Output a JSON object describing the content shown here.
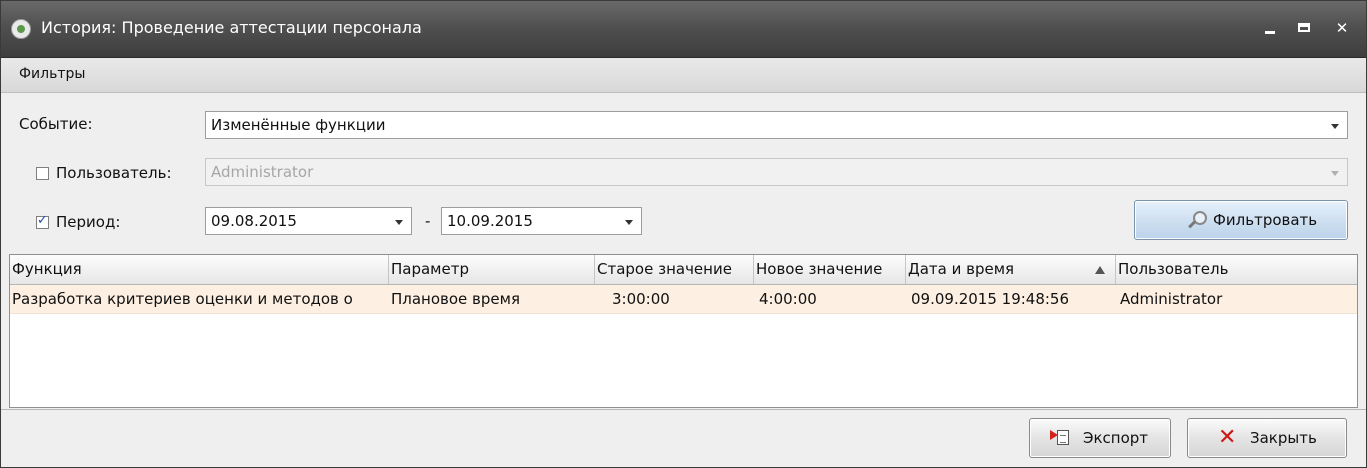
{
  "window": {
    "title": "История: Проведение аттестации персонала"
  },
  "filters": {
    "panel_title": "Фильтры",
    "event_label": "Событие:",
    "event_value": "Изменённые функции",
    "user_label": "Пользователь:",
    "user_checked": false,
    "user_value": "Administrator",
    "period_label": "Период:",
    "period_checked": true,
    "date_from": "09.08.2015",
    "date_separator": "-",
    "date_to": "10.09.2015",
    "filter_button": "Фильтровать"
  },
  "grid": {
    "columns": [
      "Функция",
      "Параметр",
      "Старое значение",
      "Новое значение",
      "Дата и время",
      "Пользователь"
    ],
    "sort_column": "Дата и время",
    "sort_direction": "ascending",
    "rows": [
      [
        "Разработка критериев оценки и методов о",
        "Плановое время",
        "3:00:00",
        "4:00:00",
        "09.09.2015 19:48:56",
        "Administrator"
      ]
    ]
  },
  "footer": {
    "export_button": "Экспорт",
    "close_button": "Закрыть"
  },
  "colors": {
    "title_bar": "#505050",
    "selected_row": "#fdf0e2",
    "filter_button": "#cfe0f1",
    "close_icon": "#cc1a14"
  }
}
